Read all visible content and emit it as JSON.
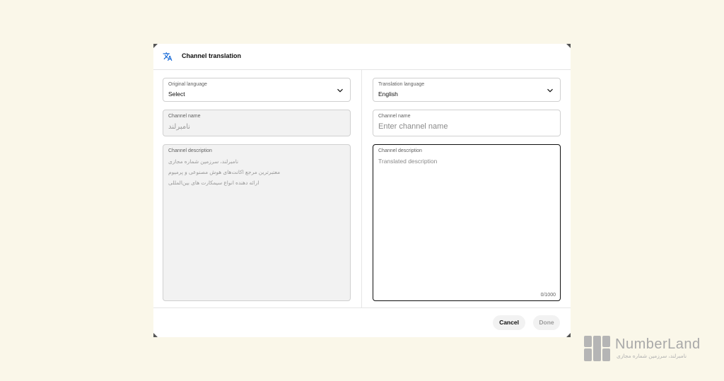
{
  "dialog": {
    "title": "Channel translation",
    "icon": "translate-icon"
  },
  "original": {
    "language": {
      "label": "Original language",
      "value": "Select"
    },
    "name": {
      "label": "Channel name",
      "value": "نامبرلند"
    },
    "description": {
      "label": "Channel description",
      "lines": [
        "نامبرلند، سرزمین شماره مجازی",
        "معتبرترین مرجع اکانت‌های هوش مصنوعی و پرمیوم",
        "ارائه دهنده انواع سیمکارت های بین‌المللی"
      ]
    }
  },
  "translation": {
    "language": {
      "label": "Translation language",
      "value": "English"
    },
    "name": {
      "label": "Channel name",
      "placeholder": "Enter channel name"
    },
    "description": {
      "label": "Channel description",
      "placeholder": "Translated description",
      "counter": "0/1000"
    }
  },
  "footer": {
    "cancel_label": "Cancel",
    "done_label": "Done"
  },
  "watermark": {
    "brand": "NumberLand",
    "tagline": "نامبرلند، سرزمین شماره مجازی"
  },
  "colors": {
    "background": "#faf7e9",
    "dialog": "#ffffff",
    "disabled_field": "#f2f2f2",
    "accent_icon": "#065fd4"
  }
}
